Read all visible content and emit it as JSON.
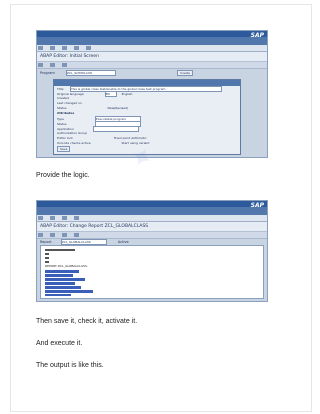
{
  "screenshot1": {
    "window_title": "ABAP Editor: Initial Screen",
    "logo": "SAP",
    "program_label": "Program",
    "program_value": "ZCL_SCIMOLAXO",
    "create_button": "Create",
    "dialog": {
      "title_label": "Title",
      "title_value": "this is global class test/enable to the global class test program",
      "orig_lang_label": "Original language",
      "orig_lang_value": "EN",
      "orig_lang_text": "English",
      "created_label": "Created",
      "changed_label": "Last changed on",
      "status_label": "Status",
      "status_value": "New(Revised)",
      "attributes_header": "Attributes",
      "type_label": "Type",
      "type_value": "Executable program",
      "status2_label": "Status",
      "application_label": "Application",
      "auth_label": "Authorization Group",
      "ldb_label": "Logical database",
      "selscreen_label": "Selection screen",
      "edit_lock": "Editor lock",
      "fixed_point": "Fixed point arithmetic",
      "unicode": "Unicode checks active",
      "start_variant": "Start using variant",
      "save_button": "Save"
    }
  },
  "caption1": "Provide the logic.",
  "screenshot2": {
    "window_title": "ABAP Editor: Change Report ZCL_GLOBALCLASS",
    "logo": "SAP",
    "report_label": "Report",
    "report_value": "ZCL_GLOBALCLASS",
    "status_value": "Active",
    "report_stmt": "REPORT ZCL_GLOBALCLASS."
  },
  "caption2": "Then save it, check it, activate it.",
  "caption3": "And execute it.",
  "caption4": "The output is like this."
}
